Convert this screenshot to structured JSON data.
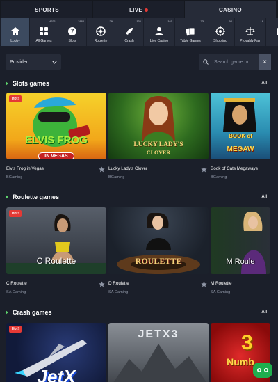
{
  "top_tabs": [
    {
      "label": "SPORTS"
    },
    {
      "label": "LIVE"
    },
    {
      "label": "CASINO"
    }
  ],
  "categories": [
    {
      "label": "Lobby",
      "count": "",
      "icon": "home-icon"
    },
    {
      "label": "All Games",
      "count": "4631",
      "icon": "grid-icon"
    },
    {
      "label": "Slots",
      "count": "1882",
      "icon": "seven-icon"
    },
    {
      "label": "Roulette",
      "count": "29",
      "icon": "roulette-icon"
    },
    {
      "label": "Crash",
      "count": "136",
      "icon": "rocket-icon"
    },
    {
      "label": "Live Casino",
      "count": "161",
      "icon": "dealer-icon"
    },
    {
      "label": "Table Games",
      "count": "73",
      "icon": "cards-icon"
    },
    {
      "label": "Shooting",
      "count": "92",
      "icon": "target-icon"
    },
    {
      "label": "Provably Fair",
      "count": "19",
      "icon": "scales-icon"
    },
    {
      "label": "Bl",
      "count": "",
      "icon": "blackjack-icon"
    }
  ],
  "filters": {
    "provider_label": "Provider",
    "search_placeholder": "Search game or"
  },
  "sections": {
    "slots": {
      "title": "Slots games",
      "all_label": "All",
      "games": [
        {
          "name": "Elvis Frog in Vegas",
          "provider": "BGaming",
          "hot": "Hot!",
          "art_text": "ELVIS FROG",
          "art_sub": "IN VEGAS"
        },
        {
          "name": "Lucky Lady's Clover",
          "provider": "BGaming",
          "art_text": "LUCKY LADY'S",
          "art_sub": "CLOVER"
        },
        {
          "name": "Book of Cats Megaways",
          "provider": "BGaming",
          "art_text": "BOOK of",
          "art_sub": "MEGAW"
        }
      ]
    },
    "roulette": {
      "title": "Roulette games",
      "all_label": "All",
      "games": [
        {
          "name": "C Roulette",
          "provider": "SA Gaming",
          "hot": "Hot!",
          "art_text": "C Roulette"
        },
        {
          "name": "D Roulette",
          "provider": "SA Gaming",
          "art_text": "ROULETTE"
        },
        {
          "name": "M Roulette",
          "provider": "SA Gaming",
          "art_text": "M Roule"
        }
      ]
    },
    "crash": {
      "title": "Crash games",
      "all_label": "All",
      "games": [
        {
          "name": "JetX",
          "hot": "Hot!",
          "art_text": "JetX"
        },
        {
          "name": "JetX3",
          "art_text": "JETX3"
        },
        {
          "name": "Number",
          "art_text": "Numb",
          "art_num": "3"
        }
      ]
    }
  },
  "colors": {
    "accent_green": "#5fd46e",
    "hot_red": "#e53935",
    "bg": "#1b1f2a",
    "panel": "#262b38"
  }
}
